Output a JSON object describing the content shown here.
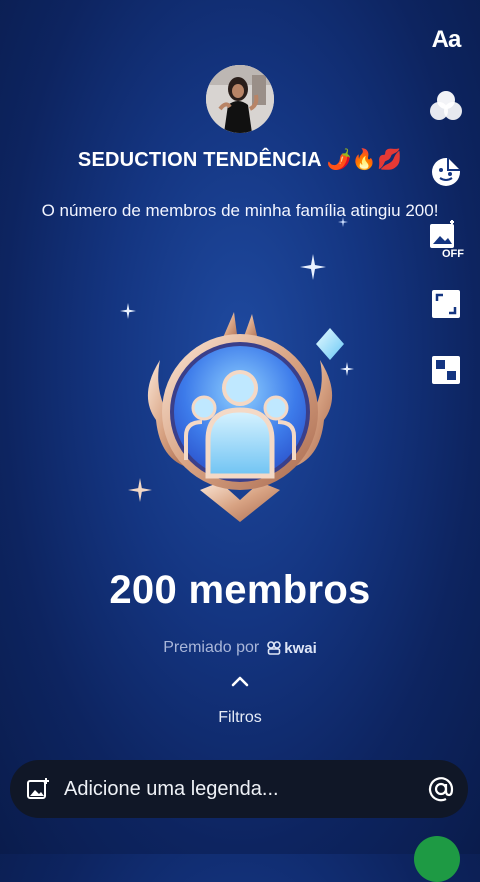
{
  "header": {
    "title": "SEDUCTION TENDÊNCIA 🌶️🔥💋",
    "subtitle": "O número de membros de minha família atingiu 200!"
  },
  "badge": {
    "count_label": "200 membros",
    "awarded_by": "Premiado por",
    "brand": "kwai"
  },
  "filters": {
    "label": "Filtros"
  },
  "toolbar": {
    "text_label": "Aa",
    "items": [
      "text-tool",
      "effects-tool",
      "sticker-tool",
      "image-off-tool",
      "resize-tool",
      "layout-tool"
    ],
    "off_label": "OFF"
  },
  "caption": {
    "placeholder": "Adicione uma legenda..."
  },
  "colors": {
    "background": "#143581",
    "send": "#1e9a44",
    "caption_bar": "#101727"
  }
}
